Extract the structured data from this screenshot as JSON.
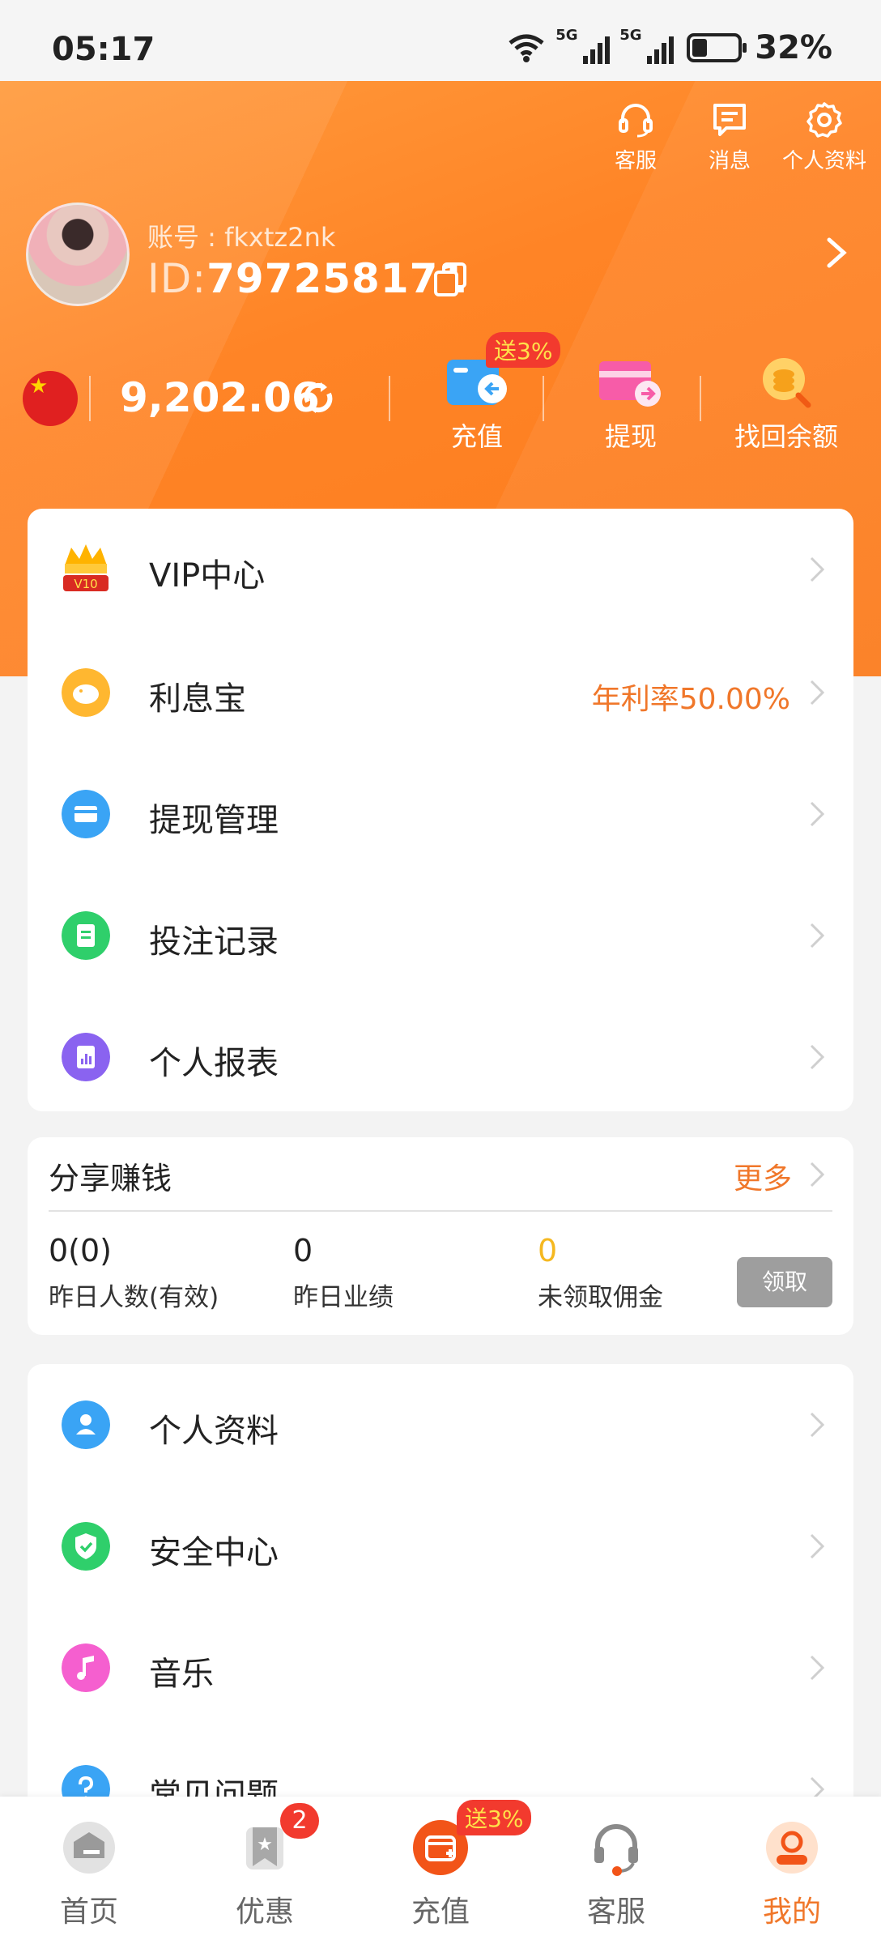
{
  "status_bar": {
    "time": "05:17",
    "net1": "5G",
    "net2": "5G",
    "battery": "32%"
  },
  "top_actions": {
    "service": "客服",
    "messages": "消息",
    "profile": "个人资料"
  },
  "user": {
    "account_label": "账号 : fkxtz2nk",
    "id_prefix": "ID:",
    "id_value": "797258171"
  },
  "wallet": {
    "balance": "9,202.06",
    "recharge": "充值",
    "recharge_bonus": "送3%",
    "withdraw": "提现",
    "recover": "找回余额"
  },
  "menu1": [
    {
      "label": "VIP中心",
      "extra": ""
    },
    {
      "label": "利息宝",
      "extra": "年利率50.00%"
    },
    {
      "label": "提现管理",
      "extra": ""
    },
    {
      "label": "投注记录",
      "extra": ""
    },
    {
      "label": "个人报表",
      "extra": ""
    }
  ],
  "vip_level": "V10",
  "share": {
    "title": "分享赚钱",
    "more": "更多",
    "stats": [
      {
        "value": "0(0)",
        "label": "昨日人数(有效)"
      },
      {
        "value": "0",
        "label": "昨日业绩"
      },
      {
        "value": "0",
        "label": "未领取佣金"
      }
    ],
    "claim": "领取"
  },
  "menu2": [
    {
      "label": "个人资料"
    },
    {
      "label": "安全中心"
    },
    {
      "label": "音乐"
    },
    {
      "label": "常见问题"
    }
  ],
  "tabs": [
    {
      "label": "首页"
    },
    {
      "label": "优惠",
      "badge": "2"
    },
    {
      "label": "充值",
      "badge": "送3%"
    },
    {
      "label": "客服"
    },
    {
      "label": "我的"
    }
  ],
  "colors": {
    "accent": "#ff8426",
    "active_tab": "#f0772a",
    "badge": "#f23a2e"
  }
}
